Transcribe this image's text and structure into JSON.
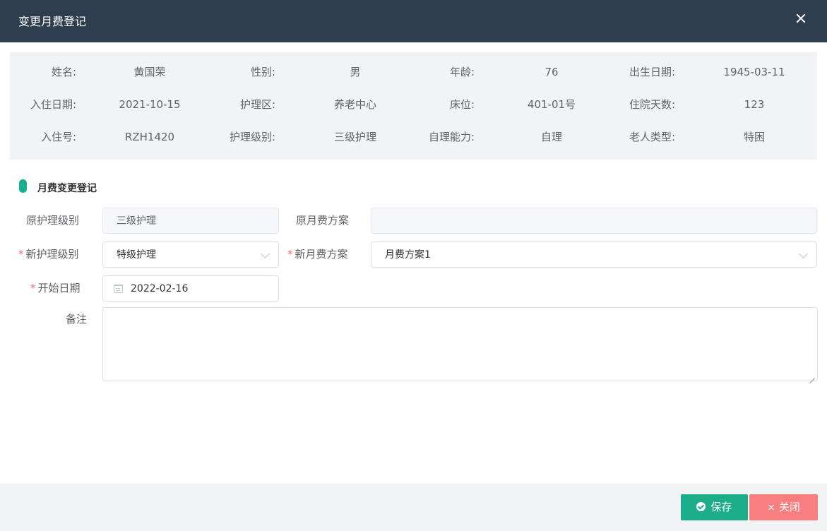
{
  "dialog": {
    "title": "变更月费登记",
    "close_label": "×"
  },
  "info": {
    "rows": [
      [
        {
          "label": "姓名:",
          "value": "黄国荣"
        },
        {
          "label": "性别:",
          "value": "男"
        },
        {
          "label": "年龄:",
          "value": "76"
        },
        {
          "label": "出生日期:",
          "value": "1945-03-11"
        }
      ],
      [
        {
          "label": "入住日期:",
          "value": "2021-10-15"
        },
        {
          "label": "护理区:",
          "value": "养老中心"
        },
        {
          "label": "床位:",
          "value": "401-01号"
        },
        {
          "label": "住院天数:",
          "value": "123"
        }
      ],
      [
        {
          "label": "入住号:",
          "value": "RZH1420"
        },
        {
          "label": "护理级别:",
          "value": "三级护理"
        },
        {
          "label": "自理能力:",
          "value": "自理"
        },
        {
          "label": "老人类型:",
          "value": "特困"
        }
      ]
    ]
  },
  "section": {
    "title": "月费变更登记",
    "accent_color": "#17b18f"
  },
  "form": {
    "required_mark": "*",
    "orig_level_label": "原护理级别",
    "orig_level_value": "三级护理",
    "orig_plan_label": "原月费方案",
    "orig_plan_value": "",
    "new_level_label": "新护理级别",
    "new_level_value": "特级护理",
    "new_plan_label": "新月费方案",
    "new_plan_value": "月费方案1",
    "start_date_label": "开始日期",
    "start_date_value": "2022-02-16",
    "remark_label": "备注",
    "remark_value": ""
  },
  "footer": {
    "save_label": "保存",
    "close_label": "关闭",
    "save_color": "#1cae8a",
    "close_color": "#f87e80",
    "close_icon": "×"
  },
  "theme": {
    "header_bg": "#2e3e4e",
    "required_color": "#f56c6c"
  }
}
